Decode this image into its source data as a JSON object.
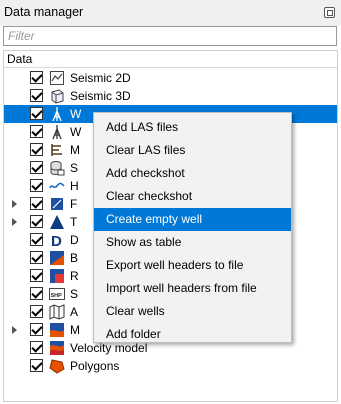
{
  "panel": {
    "title": "Data manager"
  },
  "filter": {
    "placeholder": "Filter",
    "value": ""
  },
  "tree": {
    "header": "Data",
    "items": [
      {
        "label": "Seismic 2D",
        "checked": true,
        "expandable": false,
        "selected": false,
        "icon": "seismic-2d-icon"
      },
      {
        "label": "Seismic 3D",
        "checked": true,
        "expandable": false,
        "selected": false,
        "icon": "seismic-3d-icon"
      },
      {
        "label": "Wells",
        "visible_text": "W",
        "checked": true,
        "expandable": false,
        "selected": true,
        "icon": "well-icon"
      },
      {
        "label": "W",
        "checked": true,
        "expandable": false,
        "selected": false,
        "icon": "well-log-icon"
      },
      {
        "label": "M",
        "checked": true,
        "expandable": false,
        "selected": false,
        "icon": "markers-icon"
      },
      {
        "label": "S",
        "checked": true,
        "expandable": false,
        "selected": false,
        "icon": "database-icon"
      },
      {
        "label": "H",
        "checked": true,
        "expandable": false,
        "selected": false,
        "icon": "horizon-icon"
      },
      {
        "label": "F",
        "checked": true,
        "expandable": true,
        "selected": false,
        "icon": "fault-icon"
      },
      {
        "label": "T",
        "checked": true,
        "expandable": true,
        "selected": false,
        "icon": "triangle-icon"
      },
      {
        "label": "D",
        "checked": true,
        "expandable": false,
        "selected": false,
        "icon": "d-letter-icon"
      },
      {
        "label": "B",
        "checked": true,
        "expandable": false,
        "selected": false,
        "icon": "b-icon"
      },
      {
        "label": "R",
        "checked": true,
        "expandable": false,
        "selected": false,
        "icon": "r-icon"
      },
      {
        "label": "S",
        "checked": true,
        "expandable": false,
        "selected": false,
        "icon": "shp-icon"
      },
      {
        "label": "A",
        "checked": true,
        "expandable": false,
        "selected": false,
        "icon": "map-icon"
      },
      {
        "label": "M",
        "checked": true,
        "expandable": true,
        "selected": false,
        "icon": "model-icon"
      },
      {
        "label": "Velocity model",
        "checked": true,
        "expandable": false,
        "selected": false,
        "icon": "velocity-model-icon"
      },
      {
        "label": "Polygons",
        "checked": true,
        "expandable": false,
        "selected": false,
        "icon": "polygon-icon"
      }
    ]
  },
  "context_menu": {
    "items": [
      {
        "label": "Add LAS files",
        "highlighted": false
      },
      {
        "label": "Clear LAS files",
        "highlighted": false
      },
      {
        "label": "Add checkshot",
        "highlighted": false
      },
      {
        "label": "Clear checkshot",
        "highlighted": false
      },
      {
        "label": "Create empty well",
        "highlighted": true
      },
      {
        "label": "Show as table",
        "highlighted": false
      },
      {
        "label": "Export well headers to file",
        "highlighted": false
      },
      {
        "label": "Import well headers from file",
        "highlighted": false
      },
      {
        "label": "Clear wells",
        "highlighted": false
      },
      {
        "label": "Add folder",
        "highlighted": false
      }
    ]
  },
  "colors": {
    "selection": "#0078d7",
    "menu_bg": "#f2f2f2"
  }
}
